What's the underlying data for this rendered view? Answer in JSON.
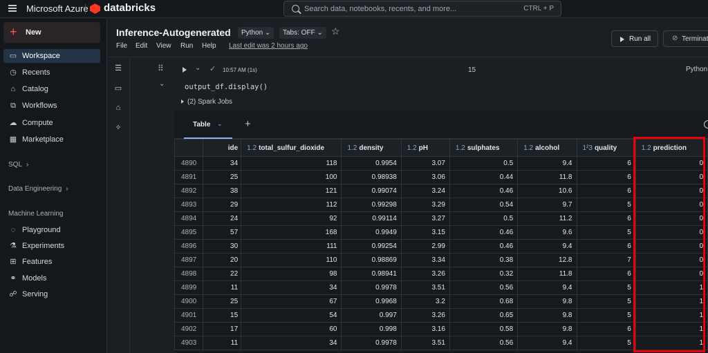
{
  "topbar": {
    "brand": "Microsoft Azure",
    "product": "databricks",
    "search_placeholder": "Search data, notebooks, recents, and more...",
    "search_shortcut": "CTRL + P"
  },
  "sidebar": {
    "new_label": "New",
    "items": [
      {
        "label": "Workspace",
        "icon": "folder-icon",
        "active": true
      },
      {
        "label": "Recents",
        "icon": "clock-icon"
      },
      {
        "label": "Catalog",
        "icon": "catalog-icon"
      },
      {
        "label": "Workflows",
        "icon": "workflow-icon"
      },
      {
        "label": "Compute",
        "icon": "cloud-icon"
      },
      {
        "label": "Marketplace",
        "icon": "store-icon"
      }
    ],
    "sections": {
      "sql": "SQL",
      "data_engineering": "Data Engineering",
      "machine_learning": "Machine Learning"
    },
    "ml_items": [
      {
        "label": "Playground",
        "icon": "playground-icon"
      },
      {
        "label": "Experiments",
        "icon": "flask-icon"
      },
      {
        "label": "Features",
        "icon": "features-icon"
      },
      {
        "label": "Models",
        "icon": "models-icon"
      },
      {
        "label": "Serving",
        "icon": "serving-icon"
      }
    ]
  },
  "notebook": {
    "title": "Inference-Autogenerated",
    "language": "Python",
    "tabs_setting": "Tabs: OFF",
    "menu": [
      "File",
      "Edit",
      "View",
      "Run",
      "Help"
    ],
    "last_edit": "Last edit was 2 hours ago",
    "run_all": "Run all",
    "terminate": "Terminat"
  },
  "cell": {
    "time": "10:57 AM (1s)",
    "number": "15",
    "language": "Python",
    "code": "output_df.display()",
    "spark_jobs": "(2) Spark Jobs"
  },
  "output": {
    "tab_label": "Table",
    "columns": [
      {
        "label": "ide",
        "type": ""
      },
      {
        "label": "total_sulfur_dioxide",
        "type": "1.2"
      },
      {
        "label": "density",
        "type": "1.2"
      },
      {
        "label": "pH",
        "type": "1.2"
      },
      {
        "label": "sulphates",
        "type": "1.2"
      },
      {
        "label": "alcohol",
        "type": "1.2"
      },
      {
        "label": "quality",
        "type": "1²3"
      },
      {
        "label": "prediction",
        "type": "1.2"
      }
    ],
    "rows": [
      [
        "4890",
        "34",
        "118",
        "0.9954",
        "3.07",
        "0.5",
        "9.4",
        "6",
        "0"
      ],
      [
        "4891",
        "25",
        "100",
        "0.98938",
        "3.06",
        "0.44",
        "11.8",
        "6",
        "0"
      ],
      [
        "4892",
        "38",
        "121",
        "0.99074",
        "3.24",
        "0.46",
        "10.6",
        "6",
        "0"
      ],
      [
        "4893",
        "29",
        "112",
        "0.99298",
        "3.29",
        "0.54",
        "9.7",
        "5",
        "0"
      ],
      [
        "4894",
        "24",
        "92",
        "0.99114",
        "3.27",
        "0.5",
        "11.2",
        "6",
        "0"
      ],
      [
        "4895",
        "57",
        "168",
        "0.9949",
        "3.15",
        "0.46",
        "9.6",
        "5",
        "0"
      ],
      [
        "4896",
        "30",
        "111",
        "0.99254",
        "2.99",
        "0.46",
        "9.4",
        "6",
        "0"
      ],
      [
        "4897",
        "20",
        "110",
        "0.98869",
        "3.34",
        "0.38",
        "12.8",
        "7",
        "0"
      ],
      [
        "4898",
        "22",
        "98",
        "0.98941",
        "3.26",
        "0.32",
        "11.8",
        "6",
        "0"
      ],
      [
        "4899",
        "11",
        "34",
        "0.9978",
        "3.51",
        "0.56",
        "9.4",
        "5",
        "1"
      ],
      [
        "4900",
        "25",
        "67",
        "0.9968",
        "3.2",
        "0.68",
        "9.8",
        "5",
        "1"
      ],
      [
        "4901",
        "15",
        "54",
        "0.997",
        "3.26",
        "0.65",
        "9.8",
        "5",
        "1"
      ],
      [
        "4902",
        "17",
        "60",
        "0.998",
        "3.16",
        "0.58",
        "9.8",
        "6",
        "1"
      ],
      [
        "4903",
        "11",
        "34",
        "0.9978",
        "3.51",
        "0.56",
        "9.4",
        "5",
        "1"
      ]
    ]
  },
  "colors": {
    "highlight": "#e8000b",
    "accent": "#8ab4f8",
    "brand": "#ff3621"
  }
}
